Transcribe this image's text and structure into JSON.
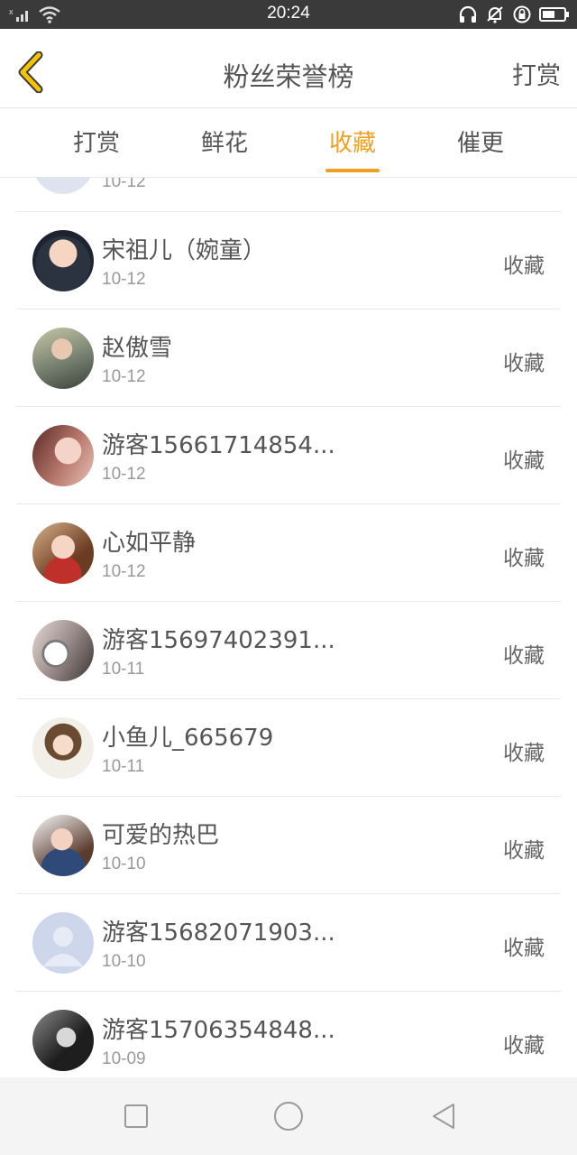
{
  "status_bar": {
    "time": "20:24"
  },
  "header": {
    "title": "粉丝荣誉榜",
    "action_label": "打赏"
  },
  "tabs": [
    {
      "label": "打赏",
      "active": false
    },
    {
      "label": "鲜花",
      "active": false
    },
    {
      "label": "收藏",
      "active": true
    },
    {
      "label": "催更",
      "active": false
    }
  ],
  "list": {
    "partial_row": {
      "date": "10-12"
    },
    "items": [
      {
        "name": "宋祖儿（婉童）",
        "date": "10-12",
        "action": "收藏"
      },
      {
        "name": "赵傲雪",
        "date": "10-12",
        "action": "收藏"
      },
      {
        "name": "游客15661714854...",
        "date": "10-12",
        "action": "收藏"
      },
      {
        "name": "心如平静",
        "date": "10-12",
        "action": "收藏"
      },
      {
        "name": "游客15697402391...",
        "date": "10-11",
        "action": "收藏"
      },
      {
        "name": "小鱼儿_665679",
        "date": "10-11",
        "action": "收藏"
      },
      {
        "name": "可爱的热巴",
        "date": "10-10",
        "action": "收藏"
      },
      {
        "name": "游客15682071903...",
        "date": "10-10",
        "action": "收藏"
      },
      {
        "name": "游客15706354848...",
        "date": "10-09",
        "action": "收藏"
      }
    ]
  },
  "colors": {
    "accent": "#f0a020",
    "status_bar": "#3a3a3a",
    "text": "#555555",
    "subtext": "#999999"
  }
}
